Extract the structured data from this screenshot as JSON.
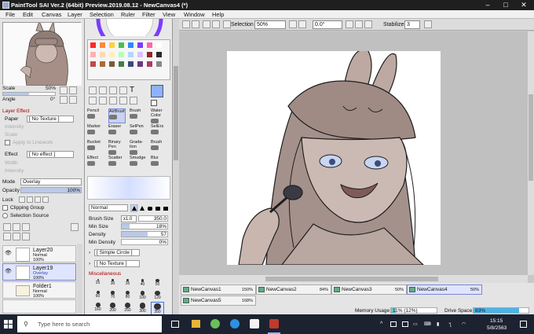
{
  "window": {
    "title": "PaintTool SAI Ver.2 (64bit) Preview.2019.08.12 - NewCanvas4 (*)"
  },
  "menu": [
    "File",
    "Edit",
    "Canvas",
    "Layer",
    "Selection",
    "Ruler",
    "Filter",
    "View",
    "Window",
    "Help"
  ],
  "toolbar": {
    "selection_label": "Selection",
    "zoom": "50%",
    "angle": "0.0°",
    "stabilizer_label": "Stabilizer",
    "stabilizer_value": "3"
  },
  "navigator": {
    "scale_label": "Scale",
    "scale_value": "50%",
    "angle_label": "Angle",
    "angle_value": "0°"
  },
  "layer_effect": {
    "header": "Layer Effect",
    "paper_label": "Paper",
    "paper_value": "[ No Texture ]",
    "intensity_label": "Intensity",
    "scale_label": "Scale",
    "apply_linework": "Apply to Linework",
    "effect_label": "Effect",
    "effect_value": "[ No effect ]",
    "width_label": "Width",
    "effect_intensity_label": "Intensity"
  },
  "layer_props": {
    "mode_label": "Mode",
    "mode_value": "Overlay",
    "opacity_label": "Opacity",
    "opacity_value": "100%",
    "opacity_fraction": 1.0,
    "lock_label": "Lock",
    "clipping_group": "Clipping Group",
    "selection_source": "Selection Source"
  },
  "layers": [
    {
      "name": "Layer20",
      "mode": "Normal",
      "opacity": "100%",
      "selected": false
    },
    {
      "name": "Layer19",
      "mode": "Overlay",
      "opacity": "100%",
      "selected": true
    },
    {
      "name": "Folder1",
      "mode": "Normal",
      "opacity": "100%",
      "selected": false
    }
  ],
  "tools": [
    [
      "Pencil",
      "AirBrush",
      "Brush",
      "Water Color"
    ],
    [
      "Marker",
      "Eraser",
      "SelPen",
      "SelErs"
    ],
    [
      "Bucket",
      "Binary Pen",
      "Grada- tion",
      "Brush"
    ],
    [
      "Effect",
      "Scatter",
      "Smudge",
      "Blur"
    ]
  ],
  "brush": {
    "blend_mode": "Normal",
    "size_label": "Brush Size",
    "size_mult": "x1.0",
    "size_value": "350.0",
    "minsize_label": "Min Size",
    "minsize_value": "18%",
    "minsize_fraction": 0.18,
    "density_label": "Density",
    "density_value": "57",
    "density_fraction": 0.57,
    "mindensity_label": "Min Density",
    "mindensity_value": "0%",
    "shape_value": "[ Simple Circle ]",
    "texture_value": "[ No Texture ]",
    "misc_label": "Miscellaneous",
    "sizes": [
      [
        "25",
        "30",
        "35",
        "40",
        "50"
      ],
      [
        "60",
        "70",
        "80",
        "100",
        "120"
      ],
      [
        "160",
        "200",
        "250",
        "300",
        "350"
      ]
    ]
  },
  "canvas_tabs": [
    {
      "name": "NewCanvas1",
      "pct": "150%"
    },
    {
      "name": "NewCanvas2",
      "pct": "84%"
    },
    {
      "name": "NewCanvas3",
      "pct": "50%"
    },
    {
      "name": "NewCanvas4",
      "pct": "50%"
    },
    {
      "name": "NewCanvas5",
      "pct": "168%"
    }
  ],
  "status": {
    "memory_label": "Memory Usage",
    "memory_value": "11% (12%)",
    "memory_fraction": 0.11,
    "drive_label": "Drive Space",
    "drive_value": "83%",
    "drive_fraction": 0.83
  },
  "taskbar": {
    "search_placeholder": "Type here to search",
    "time": "15:15",
    "date": "5/8/2563"
  },
  "colors": {
    "accent": "#3a78d8",
    "title_bg": "#1f1f1f",
    "taskbar_bg": "#1c2230",
    "selected_layer": "#dfe4ff"
  }
}
